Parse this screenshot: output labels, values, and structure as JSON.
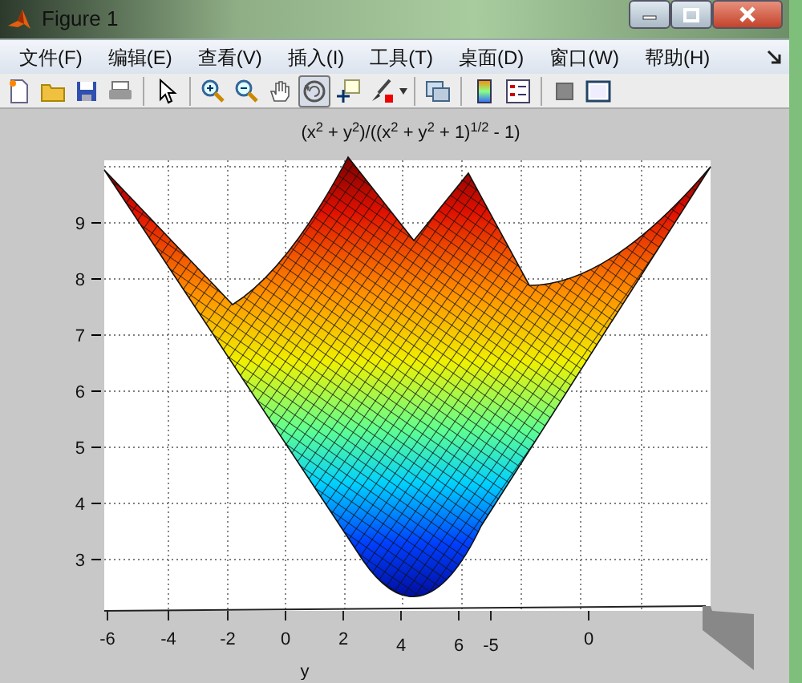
{
  "window": {
    "title": "Figure 1"
  },
  "menu": [
    {
      "label": "文件(F)"
    },
    {
      "label": "编辑(E)"
    },
    {
      "label": "查看(V)"
    },
    {
      "label": "插入(I)"
    },
    {
      "label": "工具(T)"
    },
    {
      "label": "桌面(D)"
    },
    {
      "label": "窗口(W)"
    },
    {
      "label": "帮助(H)"
    }
  ],
  "toolbar": [
    {
      "kind": "new",
      "pressed": false
    },
    {
      "kind": "open",
      "pressed": false
    },
    {
      "kind": "save",
      "pressed": false
    },
    {
      "kind": "print",
      "pressed": false
    },
    {
      "kind": "sep"
    },
    {
      "kind": "pointer",
      "pressed": false
    },
    {
      "kind": "sep"
    },
    {
      "kind": "zoomin",
      "pressed": false
    },
    {
      "kind": "zoomout",
      "pressed": false
    },
    {
      "kind": "pan",
      "pressed": false
    },
    {
      "kind": "rotate",
      "pressed": true
    },
    {
      "kind": "cursor",
      "pressed": false
    },
    {
      "kind": "brush",
      "pressed": false
    },
    {
      "kind": "caret"
    },
    {
      "kind": "sep"
    },
    {
      "kind": "link",
      "pressed": false
    },
    {
      "kind": "sep"
    },
    {
      "kind": "colorbar",
      "pressed": false
    },
    {
      "kind": "legend",
      "pressed": false
    },
    {
      "kind": "sep"
    },
    {
      "kind": "square",
      "pressed": false
    },
    {
      "kind": "frame",
      "pressed": false
    }
  ],
  "plot": {
    "title": "(x$^{2}$ + y$^{2}$)/((x$^{2}$ + y$^{2}$ + 1)$^{1/2}$ - 1)",
    "zticks": [
      "9",
      "8",
      "7",
      "6",
      "5",
      "4",
      "3"
    ],
    "xticks": [
      "-6",
      "-4",
      "-2",
      "0",
      "2",
      "4",
      "6",
      "-5",
      "0"
    ],
    "xlabel": "y"
  }
}
